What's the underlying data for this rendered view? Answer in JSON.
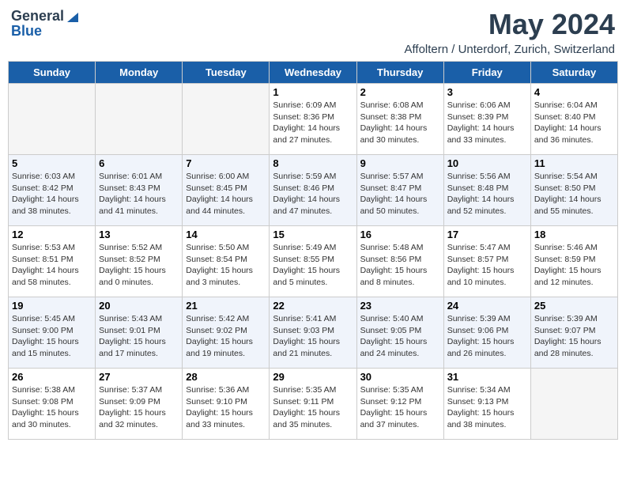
{
  "logo": {
    "general": "General",
    "blue": "Blue"
  },
  "title": {
    "month_year": "May 2024",
    "location": "Affoltern / Unterdorf, Zurich, Switzerland"
  },
  "weekdays": [
    "Sunday",
    "Monday",
    "Tuesday",
    "Wednesday",
    "Thursday",
    "Friday",
    "Saturday"
  ],
  "weeks": [
    [
      {
        "day": "",
        "info": ""
      },
      {
        "day": "",
        "info": ""
      },
      {
        "day": "",
        "info": ""
      },
      {
        "day": "1",
        "info": "Sunrise: 6:09 AM\nSunset: 8:36 PM\nDaylight: 14 hours\nand 27 minutes."
      },
      {
        "day": "2",
        "info": "Sunrise: 6:08 AM\nSunset: 8:38 PM\nDaylight: 14 hours\nand 30 minutes."
      },
      {
        "day": "3",
        "info": "Sunrise: 6:06 AM\nSunset: 8:39 PM\nDaylight: 14 hours\nand 33 minutes."
      },
      {
        "day": "4",
        "info": "Sunrise: 6:04 AM\nSunset: 8:40 PM\nDaylight: 14 hours\nand 36 minutes."
      }
    ],
    [
      {
        "day": "5",
        "info": "Sunrise: 6:03 AM\nSunset: 8:42 PM\nDaylight: 14 hours\nand 38 minutes."
      },
      {
        "day": "6",
        "info": "Sunrise: 6:01 AM\nSunset: 8:43 PM\nDaylight: 14 hours\nand 41 minutes."
      },
      {
        "day": "7",
        "info": "Sunrise: 6:00 AM\nSunset: 8:45 PM\nDaylight: 14 hours\nand 44 minutes."
      },
      {
        "day": "8",
        "info": "Sunrise: 5:59 AM\nSunset: 8:46 PM\nDaylight: 14 hours\nand 47 minutes."
      },
      {
        "day": "9",
        "info": "Sunrise: 5:57 AM\nSunset: 8:47 PM\nDaylight: 14 hours\nand 50 minutes."
      },
      {
        "day": "10",
        "info": "Sunrise: 5:56 AM\nSunset: 8:48 PM\nDaylight: 14 hours\nand 52 minutes."
      },
      {
        "day": "11",
        "info": "Sunrise: 5:54 AM\nSunset: 8:50 PM\nDaylight: 14 hours\nand 55 minutes."
      }
    ],
    [
      {
        "day": "12",
        "info": "Sunrise: 5:53 AM\nSunset: 8:51 PM\nDaylight: 14 hours\nand 58 minutes."
      },
      {
        "day": "13",
        "info": "Sunrise: 5:52 AM\nSunset: 8:52 PM\nDaylight: 15 hours\nand 0 minutes."
      },
      {
        "day": "14",
        "info": "Sunrise: 5:50 AM\nSunset: 8:54 PM\nDaylight: 15 hours\nand 3 minutes."
      },
      {
        "day": "15",
        "info": "Sunrise: 5:49 AM\nSunset: 8:55 PM\nDaylight: 15 hours\nand 5 minutes."
      },
      {
        "day": "16",
        "info": "Sunrise: 5:48 AM\nSunset: 8:56 PM\nDaylight: 15 hours\nand 8 minutes."
      },
      {
        "day": "17",
        "info": "Sunrise: 5:47 AM\nSunset: 8:57 PM\nDaylight: 15 hours\nand 10 minutes."
      },
      {
        "day": "18",
        "info": "Sunrise: 5:46 AM\nSunset: 8:59 PM\nDaylight: 15 hours\nand 12 minutes."
      }
    ],
    [
      {
        "day": "19",
        "info": "Sunrise: 5:45 AM\nSunset: 9:00 PM\nDaylight: 15 hours\nand 15 minutes."
      },
      {
        "day": "20",
        "info": "Sunrise: 5:43 AM\nSunset: 9:01 PM\nDaylight: 15 hours\nand 17 minutes."
      },
      {
        "day": "21",
        "info": "Sunrise: 5:42 AM\nSunset: 9:02 PM\nDaylight: 15 hours\nand 19 minutes."
      },
      {
        "day": "22",
        "info": "Sunrise: 5:41 AM\nSunset: 9:03 PM\nDaylight: 15 hours\nand 21 minutes."
      },
      {
        "day": "23",
        "info": "Sunrise: 5:40 AM\nSunset: 9:05 PM\nDaylight: 15 hours\nand 24 minutes."
      },
      {
        "day": "24",
        "info": "Sunrise: 5:39 AM\nSunset: 9:06 PM\nDaylight: 15 hours\nand 26 minutes."
      },
      {
        "day": "25",
        "info": "Sunrise: 5:39 AM\nSunset: 9:07 PM\nDaylight: 15 hours\nand 28 minutes."
      }
    ],
    [
      {
        "day": "26",
        "info": "Sunrise: 5:38 AM\nSunset: 9:08 PM\nDaylight: 15 hours\nand 30 minutes."
      },
      {
        "day": "27",
        "info": "Sunrise: 5:37 AM\nSunset: 9:09 PM\nDaylight: 15 hours\nand 32 minutes."
      },
      {
        "day": "28",
        "info": "Sunrise: 5:36 AM\nSunset: 9:10 PM\nDaylight: 15 hours\nand 33 minutes."
      },
      {
        "day": "29",
        "info": "Sunrise: 5:35 AM\nSunset: 9:11 PM\nDaylight: 15 hours\nand 35 minutes."
      },
      {
        "day": "30",
        "info": "Sunrise: 5:35 AM\nSunset: 9:12 PM\nDaylight: 15 hours\nand 37 minutes."
      },
      {
        "day": "31",
        "info": "Sunrise: 5:34 AM\nSunset: 9:13 PM\nDaylight: 15 hours\nand 38 minutes."
      },
      {
        "day": "",
        "info": ""
      }
    ]
  ]
}
